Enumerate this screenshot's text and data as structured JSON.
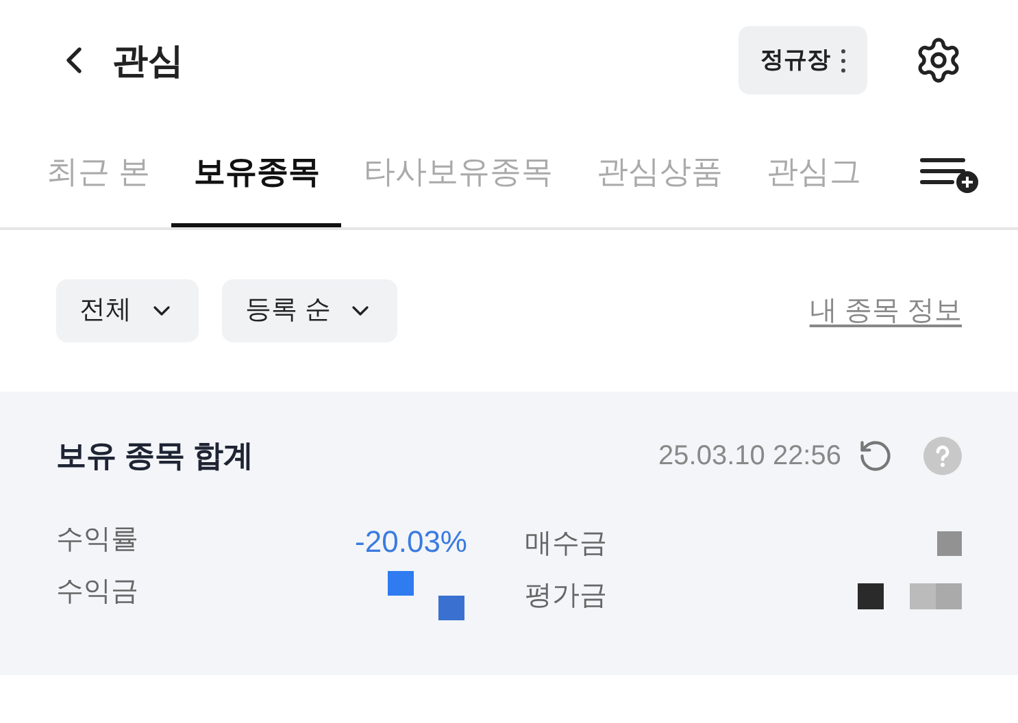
{
  "header": {
    "title": "관심",
    "market_button": "정규장"
  },
  "tabs": [
    {
      "label": "최근 본",
      "selected": false
    },
    {
      "label": "보유종목",
      "selected": true
    },
    {
      "label": "타사보유종목",
      "selected": false
    },
    {
      "label": "관심상품",
      "selected": false
    },
    {
      "label": "관심그",
      "selected": false
    }
  ],
  "filters": [
    {
      "label": "전체"
    },
    {
      "label": "등록 순"
    }
  ],
  "info_link": "내 종목 정보",
  "summary": {
    "title": "보유 종목 합계",
    "timestamp": "25.03.10 22:56",
    "rows": [
      {
        "label": "수익률",
        "value": "-20.03%",
        "label_2": "매수금"
      },
      {
        "label": "수익금",
        "label_2": "평가금"
      }
    ]
  }
}
